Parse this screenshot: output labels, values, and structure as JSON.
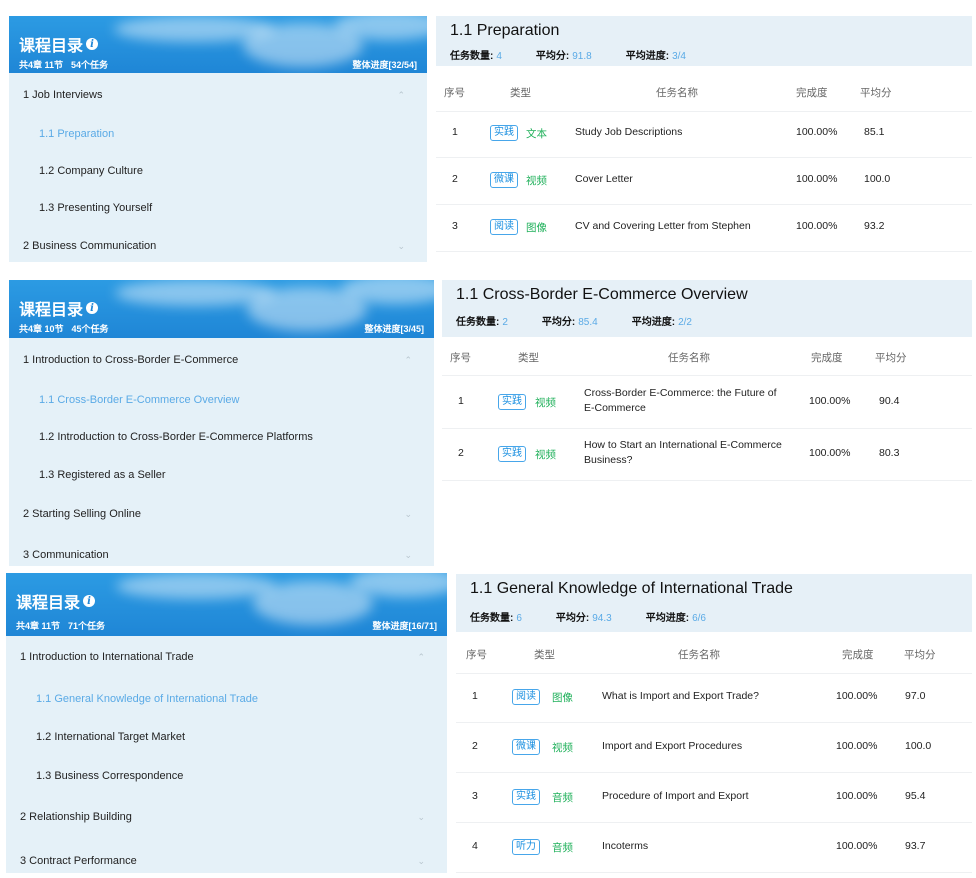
{
  "panels": [
    {
      "toc": {
        "title": "课程目录",
        "meta_chapters": "共4章 11节",
        "meta_tasks": "54个任务",
        "progress": "整体进度[32/54]",
        "items": [
          {
            "label": "1 Job Interviews",
            "level": "chapter",
            "chevron": "⌃",
            "active": false
          },
          {
            "label": "1.1 Preparation",
            "level": "section",
            "active": true
          },
          {
            "label": "1.2 Company Culture",
            "level": "section",
            "active": false
          },
          {
            "label": "1.3 Presenting Yourself",
            "level": "section",
            "active": false
          },
          {
            "label": "2 Business Communication",
            "level": "chapter",
            "chevron": "⌄",
            "active": false
          }
        ]
      },
      "tasks": {
        "title": "1.1 Preparation",
        "count_label": "任务数量:",
        "count_value": "4",
        "avg_label": "平均分:",
        "avg_value": "91.8",
        "prog_label": "平均进度:",
        "prog_value": "3/4",
        "headers": [
          "序号",
          "类型",
          "任务名称",
          "完成度",
          "平均分"
        ],
        "rows": [
          {
            "no": "1",
            "type": "实践",
            "media": "文本",
            "name": "Study Job Descriptions",
            "done": "100.00%",
            "score": "85.1"
          },
          {
            "no": "2",
            "type": "微课",
            "media": "视频",
            "name": "Cover Letter",
            "done": "100.00%",
            "score": "100.0"
          },
          {
            "no": "3",
            "type": "阅读",
            "media": "图像",
            "name": "CV and Covering Letter from Stephen",
            "done": "100.00%",
            "score": "93.2"
          }
        ]
      }
    },
    {
      "toc": {
        "title": "课程目录",
        "meta_chapters": "共4章 10节",
        "meta_tasks": "45个任务",
        "progress": "整体进度[3/45]",
        "items": [
          {
            "label": "1 Introduction to Cross-Border E-Commerce",
            "level": "chapter",
            "chevron": "⌃",
            "active": false
          },
          {
            "label": "1.1 Cross-Border E-Commerce Overview",
            "level": "section",
            "active": true
          },
          {
            "label": "1.2 Introduction to Cross-Border E-Commerce Platforms",
            "level": "section",
            "active": false
          },
          {
            "label": "1.3 Registered as a Seller",
            "level": "section",
            "active": false
          },
          {
            "label": "2 Starting Selling Online",
            "level": "chapter",
            "chevron": "⌄",
            "active": false
          },
          {
            "label": "3 Communication",
            "level": "chapter",
            "chevron": "⌄",
            "active": false
          }
        ]
      },
      "tasks": {
        "title": "1.1 Cross-Border E-Commerce Overview",
        "count_label": "任务数量:",
        "count_value": "2",
        "avg_label": "平均分:",
        "avg_value": "85.4",
        "prog_label": "平均进度:",
        "prog_value": "2/2",
        "headers": [
          "序号",
          "类型",
          "任务名称",
          "完成度",
          "平均分"
        ],
        "rows": [
          {
            "no": "1",
            "type": "实践",
            "media": "视频",
            "name": "Cross-Border E-Commerce: the Future of E-Commerce",
            "done": "100.00%",
            "score": "90.4"
          },
          {
            "no": "2",
            "type": "实践",
            "media": "视频",
            "name": "How to Start an International E-Commerce Business?",
            "done": "100.00%",
            "score": "80.3"
          }
        ]
      }
    },
    {
      "toc": {
        "title": "课程目录",
        "meta_chapters": "共4章 11节",
        "meta_tasks": "71个任务",
        "progress": "整体进度[16/71]",
        "items": [
          {
            "label": "1 Introduction to International Trade",
            "level": "chapter",
            "chevron": "⌃",
            "active": false
          },
          {
            "label": "1.1 General Knowledge of International Trade",
            "level": "section",
            "active": true
          },
          {
            "label": "1.2 International Target Market",
            "level": "section",
            "active": false
          },
          {
            "label": "1.3 Business Correspondence",
            "level": "section",
            "active": false
          },
          {
            "label": "2 Relationship Building",
            "level": "chapter",
            "chevron": "⌄",
            "active": false
          },
          {
            "label": "3 Contract Performance",
            "level": "chapter",
            "chevron": "⌄",
            "active": false
          }
        ]
      },
      "tasks": {
        "title": "1.1 General Knowledge of International Trade",
        "count_label": "任务数量:",
        "count_value": "6",
        "avg_label": "平均分:",
        "avg_value": "94.3",
        "prog_label": "平均进度:",
        "prog_value": "6/6",
        "headers": [
          "序号",
          "类型",
          "任务名称",
          "完成度",
          "平均分"
        ],
        "rows": [
          {
            "no": "1",
            "type": "阅读",
            "media": "图像",
            "name": "What is Import and Export Trade?",
            "done": "100.00%",
            "score": "97.0"
          },
          {
            "no": "2",
            "type": "微课",
            "media": "视频",
            "name": "Import and Export Procedures",
            "done": "100.00%",
            "score": "100.0"
          },
          {
            "no": "3",
            "type": "实践",
            "media": "音频",
            "name": "Procedure of Import and Export",
            "done": "100.00%",
            "score": "95.4"
          },
          {
            "no": "4",
            "type": "听力",
            "media": "音频",
            "name": "Incoterms",
            "done": "100.00%",
            "score": "93.7"
          }
        ]
      }
    }
  ]
}
